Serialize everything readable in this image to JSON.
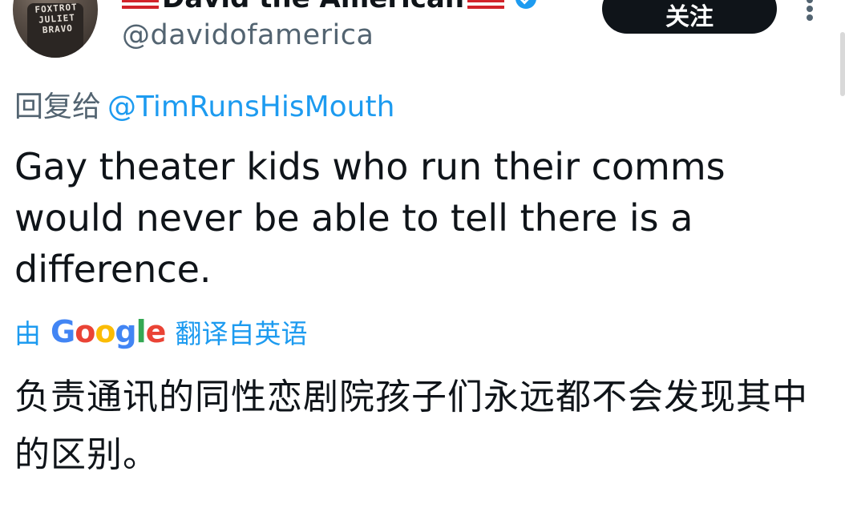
{
  "author": {
    "display_name": "David the American",
    "handle": "@davidofamerica",
    "avatar_shirt_text": "FOXTROT JULIET BRAVO"
  },
  "follow_button": {
    "label": "关注"
  },
  "reply": {
    "prefix": "回复给",
    "mention": "@TimRunsHisMouth"
  },
  "tweet": {
    "text": "Gay theater kids who run their comms would never be able to tell there is a difference."
  },
  "translation": {
    "by_label": "由",
    "provider_letters": [
      "G",
      "o",
      "o",
      "g",
      "l",
      "e"
    ],
    "suffix_label": "翻译自英语",
    "text": "负责通讯的同性恋剧院孩子们永远都不会发现其中的区别。"
  },
  "colors": {
    "link": "#1d9bf0",
    "secondary_text": "#536471",
    "primary_text": "#0f1419",
    "button_bg": "#0f1419"
  },
  "icons": {
    "verified": "verified-badge-icon",
    "more": "more-vertical-icon",
    "flag": "us-flag-emoji"
  }
}
